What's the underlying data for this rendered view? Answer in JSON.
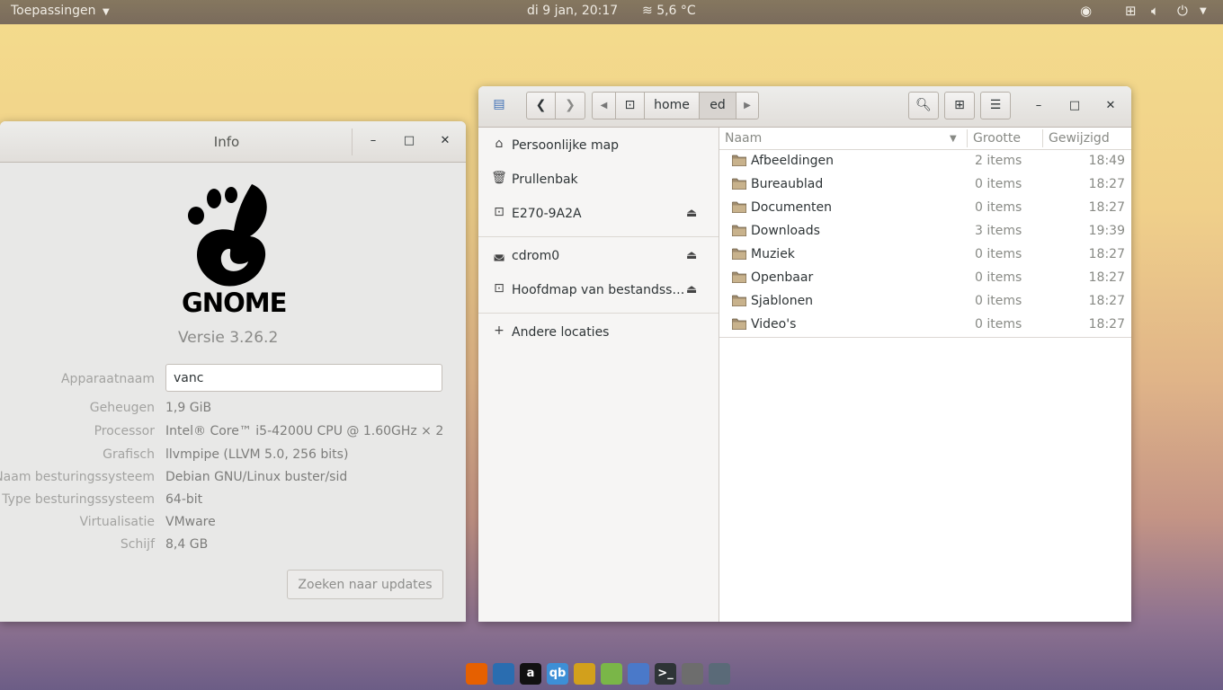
{
  "topbar": {
    "apps_label": "Toepassingen",
    "clock": "di  9 jan, 20:17",
    "weather_icon": "fog-icon",
    "weather": "5,6 °C"
  },
  "info_window": {
    "title": "Info",
    "logo_text": "GNOME",
    "version": "Versie 3.26.2",
    "fields": [
      {
        "label": "Apparaatnaam",
        "value": "vanc"
      },
      {
        "label": "Geheugen",
        "value": "1,9 GiB"
      },
      {
        "label": "Processor",
        "value": "Intel® Core™ i5-4200U CPU @ 1.60GHz × 2"
      },
      {
        "label": "Grafisch",
        "value": "llvmpipe (LLVM 5.0, 256 bits)"
      },
      {
        "label": "Naam besturingssysteem",
        "value": "Debian GNU/Linux buster/sid"
      },
      {
        "label": "Type besturingssysteem",
        "value": "64-bit"
      },
      {
        "label": "Virtualisatie",
        "value": "VMware"
      },
      {
        "label": "Schijf",
        "value": "8,4 GB"
      }
    ],
    "update_button": "Zoeken naar updates"
  },
  "files_window": {
    "path": [
      "home",
      "ed"
    ],
    "sidebar": [
      {
        "label": "Persoonlijke map",
        "icon": "home-icon"
      },
      {
        "label": "Prullenbak",
        "icon": "trash-icon"
      },
      {
        "label": "E270-9A2A",
        "icon": "drive-icon",
        "eject": true
      },
      {
        "label": "cdrom0",
        "icon": "optical-drive-icon",
        "eject": true
      },
      {
        "label": "Hoofdmap van bestandss…",
        "icon": "drive-icon",
        "eject": true
      },
      {
        "label": "Andere locaties",
        "icon": "plus-icon"
      }
    ],
    "columns": {
      "name": "Naam",
      "size": "Grootte",
      "modified": "Gewijzigd"
    },
    "rows": [
      {
        "name": "Afbeeldingen",
        "size": "2 items",
        "modified": "18:49"
      },
      {
        "name": "Bureaublad",
        "size": "0 items",
        "modified": "18:27"
      },
      {
        "name": "Documenten",
        "size": "0 items",
        "modified": "18:27"
      },
      {
        "name": "Downloads",
        "size": "3 items",
        "modified": "19:39"
      },
      {
        "name": "Muziek",
        "size": "0 items",
        "modified": "18:27"
      },
      {
        "name": "Openbaar",
        "size": "0 items",
        "modified": "18:27"
      },
      {
        "name": "Sjablonen",
        "size": "0 items",
        "modified": "18:27"
      },
      {
        "name": "Video's",
        "size": "0 items",
        "modified": "18:27"
      }
    ]
  },
  "dock": [
    {
      "name": "firefox-icon",
      "glyph": "",
      "color": "#e66000"
    },
    {
      "name": "thunderbird-icon",
      "glyph": "",
      "color": "#2a6db0"
    },
    {
      "name": "amazon-icon",
      "glyph": "a",
      "color": "#111111"
    },
    {
      "name": "qbittorrent-icon",
      "glyph": "qb",
      "color": "#3d8fd6"
    },
    {
      "name": "network-tool-icon",
      "glyph": "",
      "color": "#d2a01c"
    },
    {
      "name": "rss-reader-icon",
      "glyph": "",
      "color": "#7ab648"
    },
    {
      "name": "files-icon",
      "glyph": "",
      "color": "#4a79c9"
    },
    {
      "name": "terminal-icon",
      "glyph": ">_",
      "color": "#2e3436"
    },
    {
      "name": "gimp-icon",
      "glyph": "",
      "color": "#6d6d6d"
    },
    {
      "name": "tools-icon",
      "glyph": "",
      "color": "#5a6a78"
    }
  ]
}
